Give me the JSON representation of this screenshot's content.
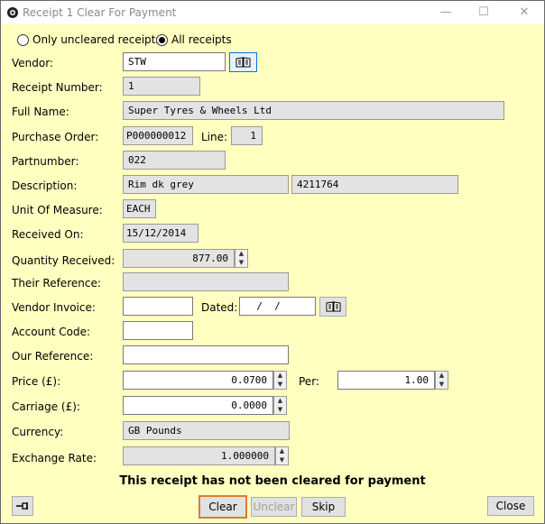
{
  "window": {
    "title": "Receipt 1 Clear For Payment"
  },
  "filter": {
    "option1": "Only uncleared receipts",
    "option2": "All receipts",
    "selected": "All receipts"
  },
  "labels": {
    "vendor": "Vendor:",
    "receipt_number": "Receipt Number:",
    "full_name": "Full Name:",
    "purchase_order": "Purchase Order:",
    "line": "Line:",
    "partnumber": "Partnumber:",
    "description": "Description:",
    "unit_of_measure": "Unit Of Measure:",
    "received_on": "Received On:",
    "quantity_received": "Quantity Received:",
    "their_reference": "Their Reference:",
    "vendor_invoice": "Vendor Invoice:",
    "dated": "Dated:",
    "account_code": "Account Code:",
    "our_reference": "Our Reference:",
    "price": "Price (£):",
    "per": "Per:",
    "carriage": "Carriage (£):",
    "currency": "Currency:",
    "exchange_rate": "Exchange Rate:"
  },
  "values": {
    "vendor": "STW",
    "receipt_number": "1",
    "full_name": "Super Tyres & Wheels Ltd",
    "purchase_order": "P000000012",
    "line": "1",
    "partnumber": "022",
    "description": "Rim dk grey",
    "description2": "4211764",
    "unit_of_measure": "EACH",
    "received_on": "15/12/2014",
    "quantity_received": "877.00",
    "their_reference": "",
    "vendor_invoice": "",
    "dated": "  /  /",
    "account_code": "",
    "our_reference": "",
    "price": "0.0700",
    "per": "1.00",
    "carriage": "0.0000",
    "currency": "GB Pounds",
    "exchange_rate": "1.000000"
  },
  "status_message": "This receipt has not been cleared for payment",
  "buttons": {
    "clear": "Clear",
    "unclear": "Unclear",
    "skip": "Skip",
    "close": "Close"
  }
}
